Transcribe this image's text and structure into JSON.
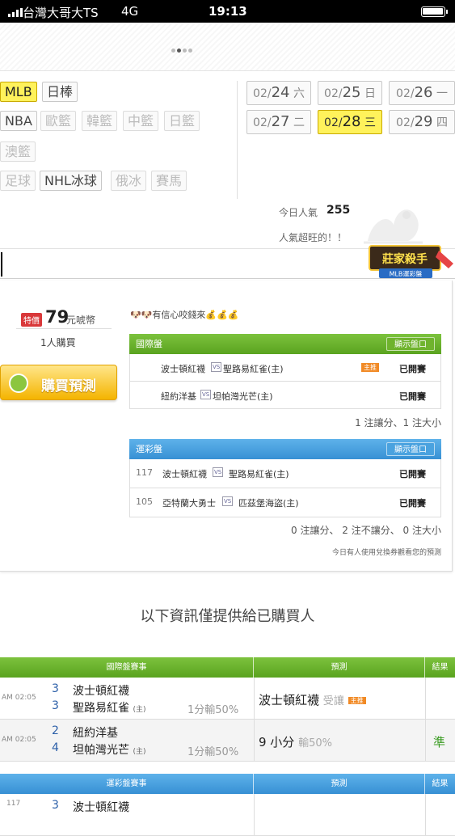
{
  "status": {
    "carrier": "台灣大哥大TS",
    "network": "4G",
    "time": "19:13"
  },
  "sports": {
    "row1": [
      "MLB",
      "日棒"
    ],
    "row2": [
      "NBA",
      "歐籃",
      "韓籃",
      "中籃",
      "日籃"
    ],
    "row3": [
      "澳籃"
    ],
    "row4": [
      "足球",
      "NHL冰球",
      "俄冰",
      "賽馬"
    ],
    "active": "MLB"
  },
  "dates": [
    {
      "md": "02/",
      "d": "24",
      "wd": "六"
    },
    {
      "md": "02/",
      "d": "25",
      "wd": "日"
    },
    {
      "md": "02/",
      "d": "26",
      "wd": "一"
    },
    {
      "md": "02/",
      "d": "27",
      "wd": "二"
    },
    {
      "md": "02/",
      "d": "28",
      "wd": "三"
    },
    {
      "md": "02/",
      "d": "29",
      "wd": "四"
    }
  ],
  "active_date": "02/28",
  "popularity": {
    "label": "今日人氣",
    "value": "255",
    "note": "人氣超旺的！！"
  },
  "brand": {
    "name": "莊家殺手",
    "sub": "MLB運彩盤"
  },
  "product": {
    "badge": "特價",
    "price": "79",
    "unit": "元唬幣",
    "buyers": "1人購買",
    "buy_label": "購買預測",
    "confidence": "有信心咬錢來"
  },
  "intl": {
    "title": "國際盤",
    "show_label": "顯示盤口",
    "games": [
      {
        "team1": "波士頓紅襪",
        "team2": "聖路易紅雀(主)",
        "tag": "主推",
        "status": "已開賽"
      },
      {
        "team1": "紐約洋基",
        "team2": "坦帕灣光芒(主)",
        "tag": "",
        "status": "已開賽"
      }
    ],
    "summary": "1 注讓分、1 注大小"
  },
  "lottery": {
    "title": "運彩盤",
    "show_label": "顯示盤口",
    "games": [
      {
        "num": "117",
        "team1": "波士頓紅襪",
        "team2": "聖路易紅雀(主)",
        "status": "已開賽"
      },
      {
        "num": "105",
        "team1": "亞特蘭大勇士",
        "team2": "匹茲堡海盜(主)",
        "status": "已開賽"
      }
    ],
    "summary": "0 注讓分、 2 注不讓分、 0 注大小",
    "note": "今日有人使用兌換券觀看您的預測"
  },
  "info_title": "以下資訊僅提供給已購買人",
  "intl_table": {
    "headers": [
      "國際盤賽事",
      "預測",
      "結果"
    ],
    "rows": [
      {
        "time": "AM 02:05",
        "r1": "3",
        "t1": "波士頓紅襪",
        "r2": "3",
        "t2": "聖路易紅雀",
        "home": "(主)",
        "line": "1分輸50%",
        "pick": "波士頓紅襪",
        "pick_note": "受讓",
        "pick_tag": "主推",
        "result": ""
      },
      {
        "time": "AM 02:05",
        "r1": "2",
        "t1": "紐約洋基",
        "r2": "4",
        "t2": "坦帕灣光芒",
        "home": "(主)",
        "line": "1分輸50%",
        "pick": "9 小分",
        "pick_note": "輸50%",
        "pick_tag": "",
        "result": "準"
      }
    ]
  },
  "lottery_table": {
    "headers": [
      "運彩盤賽事",
      "預測",
      "結果"
    ],
    "rows": [
      {
        "num": "117",
        "r1": "3",
        "t1": "波士頓紅襪"
      }
    ]
  },
  "colors": {
    "active_yellow": "#fff25b",
    "green": "#6cb52f",
    "blue": "#4aa2df",
    "tag_orange": "#f18a25",
    "price_red": "#d9383a"
  }
}
